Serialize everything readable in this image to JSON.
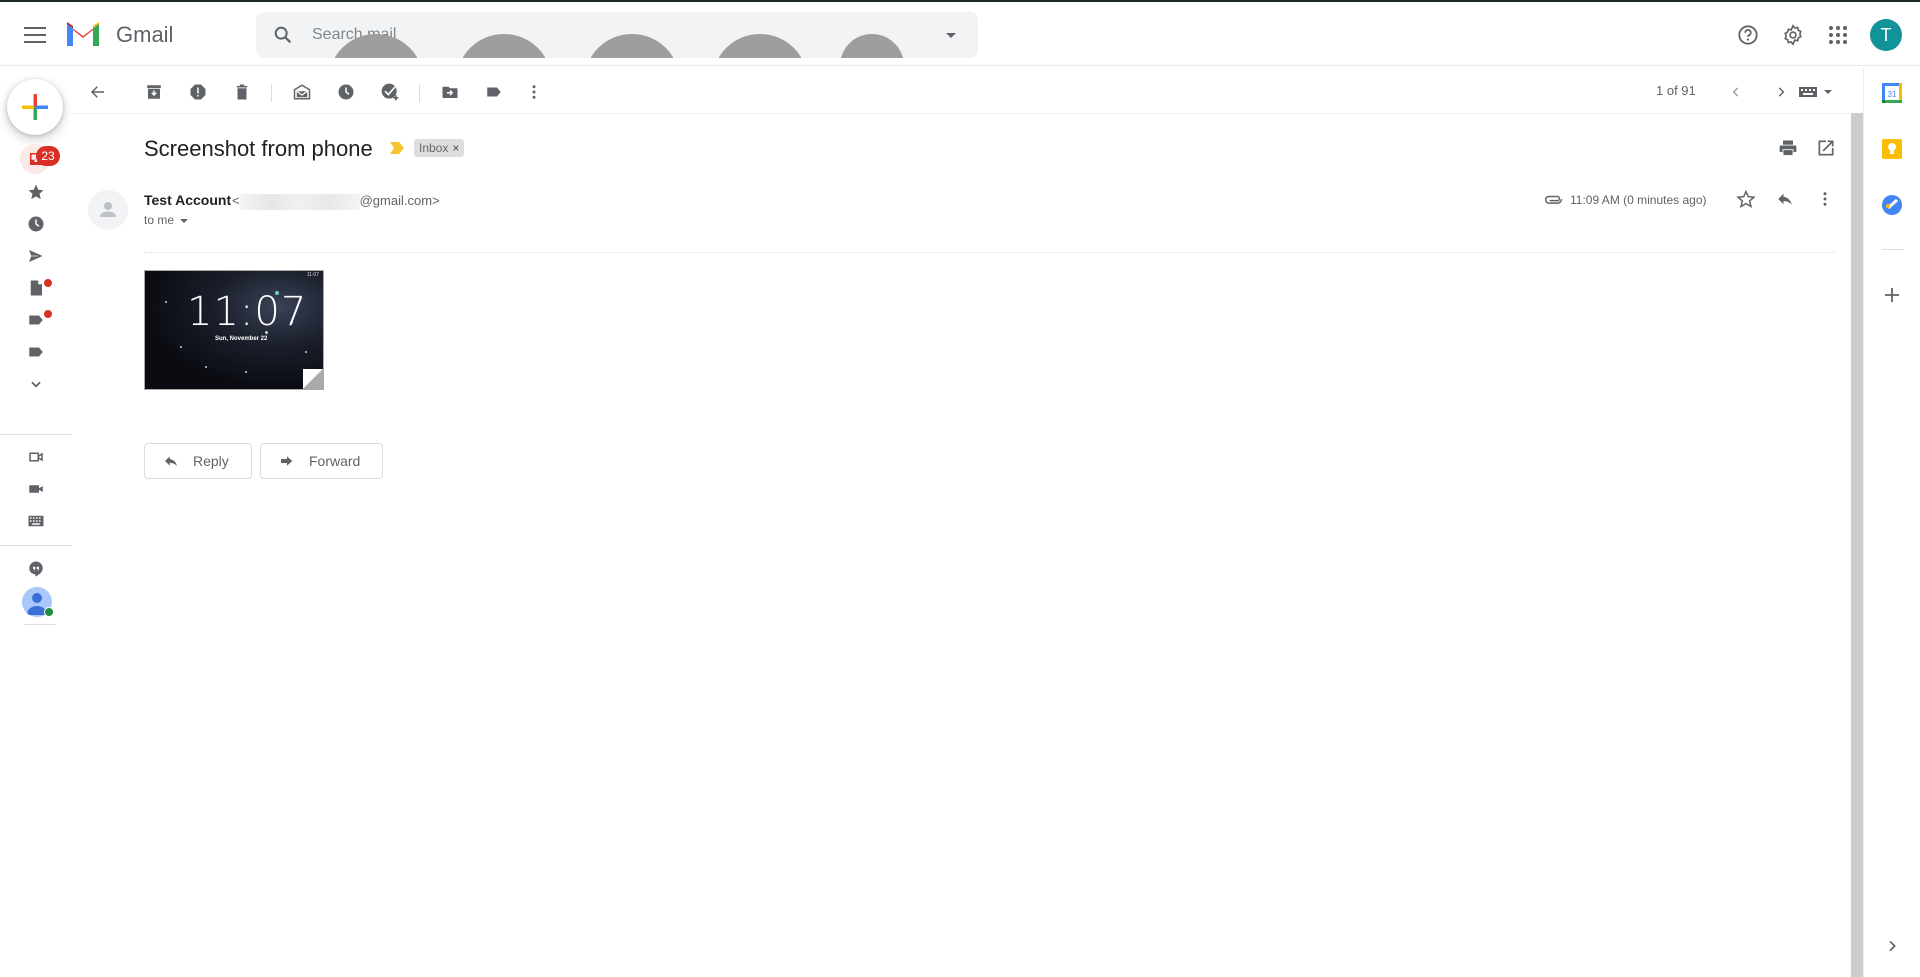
{
  "header": {
    "brand": "Gmail",
    "search_placeholder": "Search mail",
    "avatar_initial": "T",
    "icons": [
      "main-menu-icon",
      "gmail-logo",
      "search-icon",
      "search-options-icon",
      "help-icon",
      "settings-icon",
      "apps-icon",
      "account-avatar"
    ]
  },
  "leftnav": {
    "inbox_unread": "23",
    "items": [
      "inbox",
      "starred",
      "snoozed",
      "sent",
      "drafts",
      "important",
      "labels",
      "more"
    ],
    "meet": [
      "new-meeting",
      "join-meeting",
      "keyboard"
    ],
    "chat": [
      "hangouts",
      "contact"
    ]
  },
  "toolbar": {
    "actions": [
      "back",
      "archive",
      "report-spam",
      "delete",
      "mark-unread",
      "snooze",
      "add-to-tasks",
      "move-to",
      "labels",
      "more"
    ],
    "pager": "1 of 91"
  },
  "message": {
    "subject": "Screenshot from phone",
    "label": "Inbox",
    "label_remove": "×",
    "sender_name": "Test Account",
    "sender_email_prefix": "<",
    "sender_email_suffix": "@gmail.com>",
    "recipient": "to me",
    "time": "11:09 AM (0 minutes ago)",
    "attachment": {
      "clock": "11:07",
      "date": "Sun, November 22",
      "status_time": "11:07"
    }
  },
  "actions": {
    "reply": "Reply",
    "forward": "Forward"
  },
  "colors": {
    "accent": "#12939a",
    "badge": "#d93025",
    "important": "#f4c430"
  }
}
